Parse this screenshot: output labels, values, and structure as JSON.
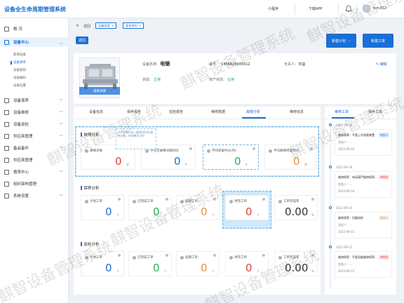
{
  "app": {
    "title": "设备全生命周期管理系统"
  },
  "topbar": {
    "mini_program": "小程序",
    "download_app": "下载APP",
    "user": "tsm312"
  },
  "sidebar": {
    "items": [
      {
        "label": "概 况"
      },
      {
        "label": "设备中心"
      },
      {
        "label": "设备保养"
      },
      {
        "label": "设备维修"
      },
      {
        "label": "设备巡检"
      },
      {
        "label": "供应商管理"
      },
      {
        "label": "备品备件"
      },
      {
        "label": "供应商管理"
      },
      {
        "label": "报表中心"
      },
      {
        "label": "组织架构管理"
      },
      {
        "label": "系统设置"
      }
    ],
    "sub_items": [
      "新增设备",
      "设备清单",
      "设备类别",
      "设备编码",
      "设备位置"
    ]
  },
  "filters": {
    "back": "返回",
    "chip1": "设备档案",
    "chip2": "基本资料"
  },
  "buttons": {
    "back": "返回",
    "create_plan": "新建计划",
    "create_order": "新建工单"
  },
  "device": {
    "name_label": "设备名称:",
    "name": "电锯",
    "code_label": "编号:",
    "code": "1456620045512",
    "owner_label": "负责人:",
    "owner": "许益",
    "status_label": "状态:",
    "status": "正常",
    "asset_label": "资产状态:",
    "asset": "在用",
    "image_caption": "查看详情",
    "edit": "编辑"
  },
  "tabs": [
    "设备信息",
    "保养报告",
    "巡检报告",
    "维修数据",
    "故障分析",
    "维修信息"
  ],
  "active_tab": 4,
  "sections": {
    "fault": {
      "title": "故障分析",
      "stats": [
        {
          "label": "故障次数",
          "value": "0",
          "unit": "次"
        },
        {
          "label": "平均无故障间隔时间",
          "value": "0",
          "unit": "h"
        },
        {
          "label": "平均修复时长(时)",
          "value": "0",
          "unit": "h"
        },
        {
          "label": "平均故障修复时间",
          "value": "0",
          "unit": "次"
        }
      ],
      "tooltip": "平均修复时长=维修总时长/维修次数，时间单位小时"
    },
    "maint": {
      "title": "保养分析",
      "stats": [
        {
          "label": "计划工单",
          "value": "0",
          "unit": "个"
        },
        {
          "label": "已完成工单",
          "value": "0",
          "unit": "个"
        },
        {
          "label": "逾期工单",
          "value": "0",
          "unit": "个"
        },
        {
          "label": "待完工单",
          "value": "0",
          "unit": "个"
        },
        {
          "label": "工单完成率",
          "value": "0.00",
          "unit": "%"
        }
      ]
    },
    "inspect": {
      "title": "巡检分析",
      "stats": [
        {
          "label": "计划工单",
          "value": "0",
          "unit": "个"
        },
        {
          "label": "已完成工单",
          "value": "0",
          "unit": "个"
        },
        {
          "label": "逾期工单",
          "value": "0",
          "unit": "个"
        },
        {
          "label": "待完工单",
          "value": "0",
          "unit": "个"
        },
        {
          "label": "工单完成率",
          "value": "0.00",
          "unit": "%"
        }
      ]
    }
  },
  "right_panel": {
    "tab1": "维修工单",
    "tab2": "保养工单",
    "entries": [
      {
        "date": "2022-09-16",
        "title": "维修保养：平面上升轮毂装置",
        "person": "发起人：...",
        "time": "2022-09-16",
        "badge": "待执行",
        "badge_color": "#1a6fd6"
      },
      {
        "date": "2022-09-16",
        "title": "维修保养：电动葫芦维修保养...",
        "person": "发起人：...",
        "time": "2022-09-16",
        "badge": "待审核",
        "badge_color": "#e0433a"
      },
      {
        "date": "2022-09-15",
        "title": "维修保养：设备巡检",
        "person": "发起人：...",
        "time": "2022-09-15",
        "badge": "待执行",
        "badge_color": "#e8913a"
      },
      {
        "date": "2022-09-15",
        "title": "维修保养：平面设备维修保养...",
        "person": "发起人：...",
        "time": "2022-09-15",
        "badge": "待审核",
        "badge_color": "#e0433a"
      }
    ]
  },
  "watermark": "麒智设备管理系统",
  "colors": {
    "red": "#e0433a",
    "green": "#27ae60",
    "blue": "#1a6fd6",
    "orange": "#e8913a"
  }
}
